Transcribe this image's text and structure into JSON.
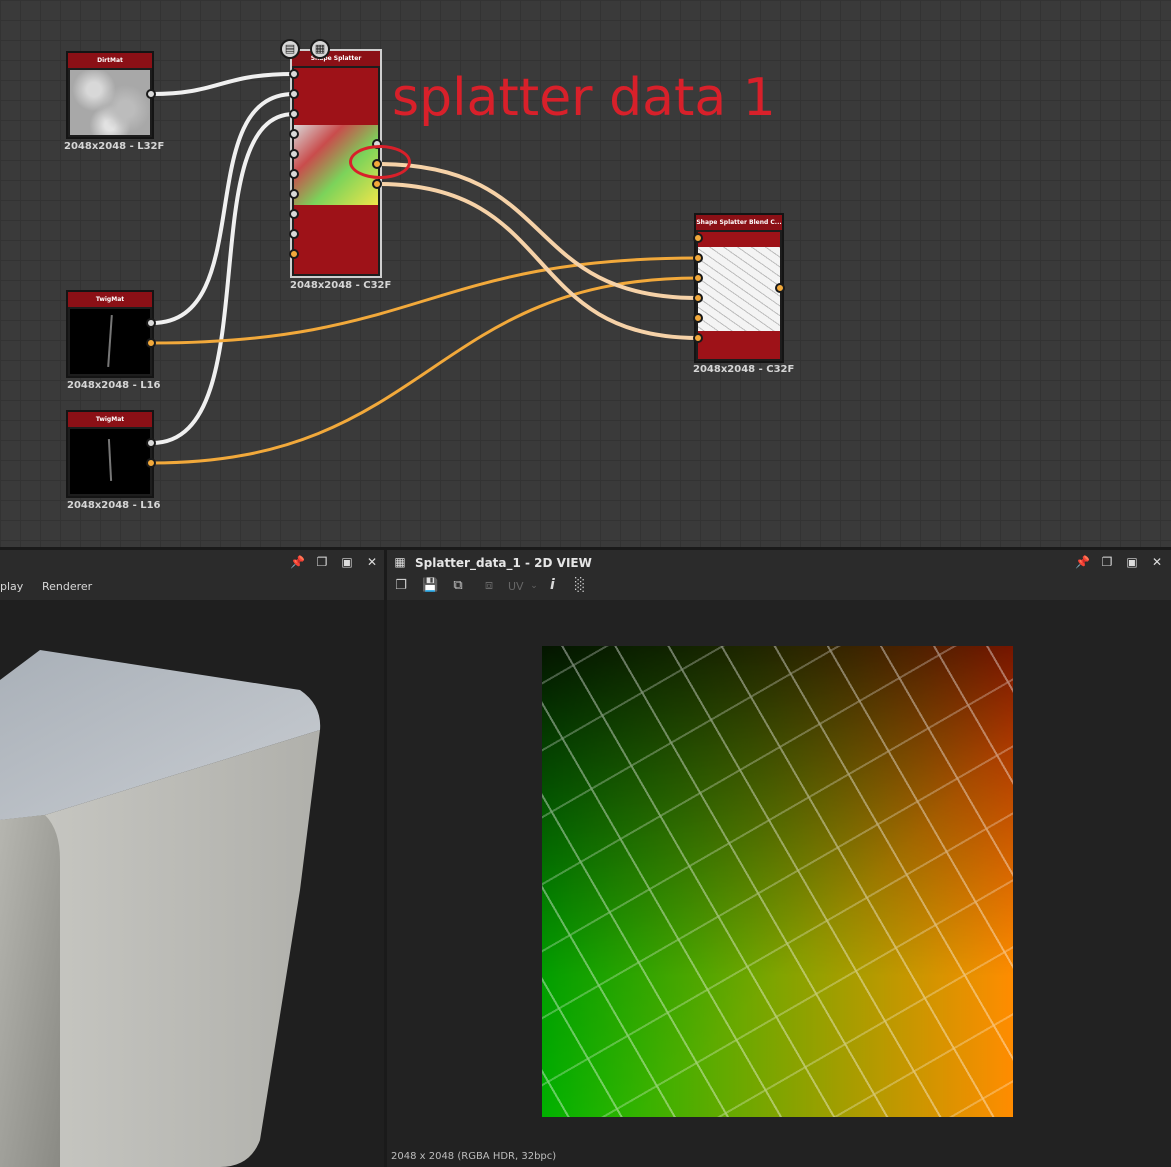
{
  "graph": {
    "annotation": "splatter data 1",
    "nodes": {
      "dirt": {
        "title": "DirtMat",
        "label": "2048x2048 - L32F"
      },
      "splatter": {
        "title": "Shape Splatter",
        "label": "2048x2048 - C32F"
      },
      "twig1": {
        "title": "TwigMat",
        "label": "2048x2048 - L16"
      },
      "twig2": {
        "title": "TwigMat",
        "label": "2048x2048 - L16"
      },
      "blend": {
        "title": "Shape Splatter Blend C...",
        "label": "2048x2048 - C32F"
      }
    },
    "colors": {
      "wire_white": "#f0f0f0",
      "wire_orange": "#f2a93b",
      "wire_peach": "#f6d2a8",
      "node_header": "#8b1016",
      "annotation": "#d8202a"
    }
  },
  "left_panel": {
    "menu": [
      "play",
      "Renderer"
    ]
  },
  "right_panel": {
    "title": "Splatter_data_1 - 2D VIEW",
    "toolbar": {
      "uv_label": "UV",
      "info_label": "i"
    },
    "status": "2048 x 2048 (RGBA HDR, 32bpc)"
  }
}
